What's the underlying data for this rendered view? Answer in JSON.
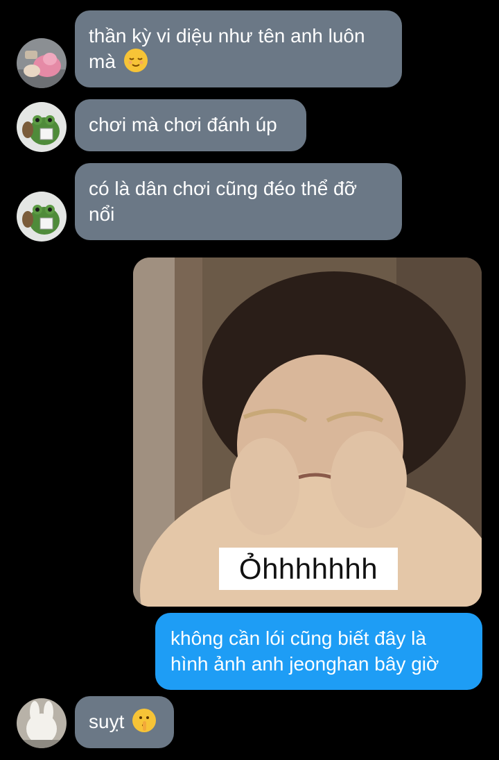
{
  "messages": [
    {
      "text": "thần kỳ vi diệu như tên anh luôn",
      "text2": "mà",
      "emoji": "relieved-face-emoji"
    },
    {
      "text": "chơi mà chơi đánh úp"
    },
    {
      "text": "có là dân chơi cũng đéo thể đỡ",
      "text2": "nổi"
    },
    {
      "image_caption": "Ỏhhhhhhh"
    },
    {
      "text": "không cần lói cũng biết đây là",
      "text2": "hình ảnh anh jeonghan bây giờ"
    },
    {
      "text": "suỵt",
      "emoji": "shushing-face-emoji"
    }
  ],
  "colors": {
    "background": "#000000",
    "incoming_bubble": "#6b7886",
    "outgoing_bubble": "#1e9df5",
    "text": "#ffffff"
  }
}
